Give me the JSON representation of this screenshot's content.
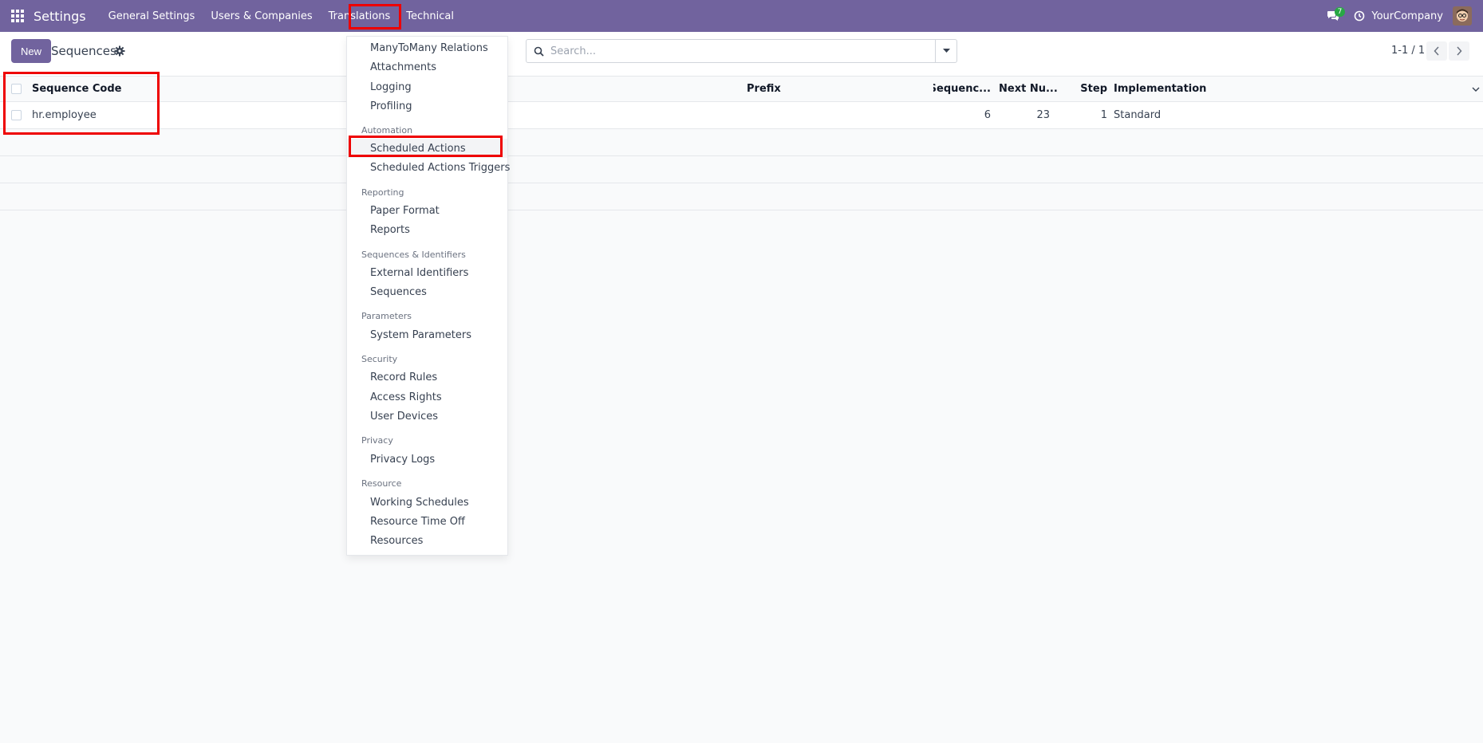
{
  "navbar": {
    "app_name": "Settings",
    "menu": [
      "General Settings",
      "Users & Companies",
      "Translations",
      "Technical"
    ],
    "chat_count": "7",
    "company": "YourCompany",
    "bg_color": "#71639e"
  },
  "control_panel": {
    "new_label": "New",
    "title": "Sequences",
    "search_placeholder": "Search...",
    "pager": "1-1 / 1"
  },
  "list": {
    "columns": {
      "code": "Sequence Code",
      "prefix": "Prefix",
      "sequence_size": "Sequenc...",
      "next_number": "Next Nu...",
      "step": "Step",
      "implementation": "Implementation"
    },
    "rows": [
      {
        "code": "hr.employee",
        "prefix": "",
        "sequence_size": "6",
        "next_number": "23",
        "step": "1",
        "implementation": "Standard"
      }
    ]
  },
  "technical_menu": {
    "top_items": [
      "ManyToMany Relations",
      "Attachments",
      "Logging",
      "Profiling"
    ],
    "automation": {
      "title": "Automation",
      "items": [
        "Scheduled Actions",
        "Scheduled Actions Triggers"
      ]
    },
    "reporting": {
      "title": "Reporting",
      "items": [
        "Paper Format",
        "Reports"
      ]
    },
    "sequences_identifiers": {
      "title": "Sequences & Identifiers",
      "items": [
        "External Identifiers",
        "Sequences"
      ]
    },
    "parameters": {
      "title": "Parameters",
      "items": [
        "System Parameters"
      ]
    },
    "security": {
      "title": "Security",
      "items": [
        "Record Rules",
        "Access Rights",
        "User Devices"
      ]
    },
    "privacy": {
      "title": "Privacy",
      "items": [
        "Privacy Logs"
      ]
    },
    "resource": {
      "title": "Resource",
      "items": [
        "Working Schedules",
        "Resource Time Off",
        "Resources"
      ]
    }
  },
  "icons": {
    "apps": "apps-grid-icon",
    "chat": "chat-icon",
    "activity": "clock-icon",
    "settings": "gear-icon",
    "search": "search-icon",
    "toggle": "caret-down-icon",
    "prev": "chevron-left-icon",
    "next": "chevron-right-icon"
  },
  "colors": {
    "accent": "#71639e",
    "highlight": "#ee0000",
    "badge": "#28a745"
  }
}
